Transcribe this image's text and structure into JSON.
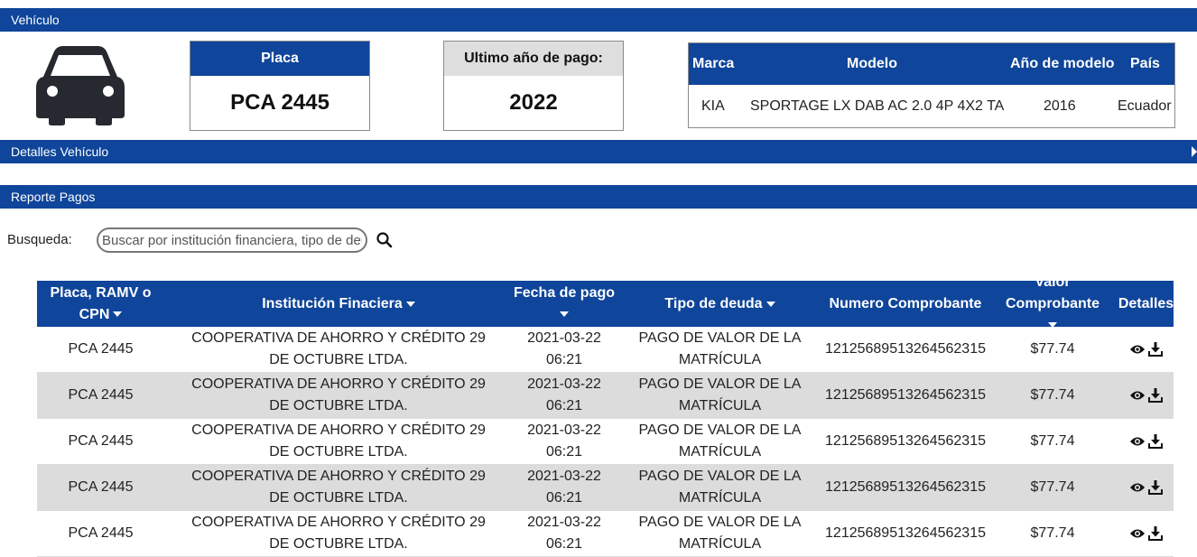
{
  "sections": {
    "vehicle": "Vehículo",
    "vehicle_details": "Detalles Vehículo",
    "payments_report": "Reporte Pagos"
  },
  "plate_card": {
    "label": "Placa",
    "value": "PCA 2445"
  },
  "last_payment_card": {
    "label": "Ultimo año de pago:",
    "value": "2022"
  },
  "vehicle_info": {
    "headers": {
      "brand": "Marca",
      "model": "Modelo",
      "model_year": "Año de modelo",
      "country": "País"
    },
    "values": {
      "brand": "KIA",
      "model": "SPORTAGE LX DAB AC 2.0 4P 4X2 TA",
      "model_year": "2016",
      "country": "Ecuador"
    }
  },
  "search": {
    "label": "Busqueda:",
    "placeholder": "Buscar por institución financiera, tipo de deuda",
    "value": ""
  },
  "table": {
    "headers": {
      "plate_line1": "Placa, RAMV o",
      "plate_line2": "CPN",
      "institution": "Institución Finaciera",
      "date": "Fecha de pago",
      "debt_type": "Tipo de deuda",
      "receipt_number": "Numero Comprobante",
      "receipt_value": "Valor Comprobante",
      "details": "Detalles"
    },
    "rows": [
      {
        "plate": "PCA 2445",
        "institution": "COOPERATIVA DE AHORRO Y CRÉDITO 29 DE OCTUBRE LTDA.",
        "date": "2021-03-22 06:21",
        "debt_type": "PAGO DE VALOR DE LA MATRÍCULA",
        "receipt_number": "12125689513264562315",
        "value": "$77.74"
      },
      {
        "plate": "PCA 2445",
        "institution": "COOPERATIVA DE AHORRO Y CRÉDITO 29 DE OCTUBRE LTDA.",
        "date": "2021-03-22 06:21",
        "debt_type": "PAGO DE VALOR DE LA MATRÍCULA",
        "receipt_number": "12125689513264562315",
        "value": "$77.74"
      },
      {
        "plate": "PCA 2445",
        "institution": "COOPERATIVA DE AHORRO Y CRÉDITO 29 DE OCTUBRE LTDA.",
        "date": "2021-03-22 06:21",
        "debt_type": "PAGO DE VALOR DE LA MATRÍCULA",
        "receipt_number": "12125689513264562315",
        "value": "$77.74"
      },
      {
        "plate": "PCA 2445",
        "institution": "COOPERATIVA DE AHORRO Y CRÉDITO 29 DE OCTUBRE LTDA.",
        "date": "2021-03-22 06:21",
        "debt_type": "PAGO DE VALOR DE LA MATRÍCULA",
        "receipt_number": "12125689513264562315",
        "value": "$77.74"
      },
      {
        "plate": "PCA 2445",
        "institution": "COOPERATIVA DE AHORRO Y CRÉDITO 29 DE OCTUBRE LTDA.",
        "date": "2021-03-22 06:21",
        "debt_type": "PAGO DE VALOR DE LA MATRÍCULA",
        "receipt_number": "12125689513264562315",
        "value": "$77.74"
      }
    ]
  },
  "icons": {
    "vehicle": "car-icon",
    "search": "search-icon",
    "view": "eye-icon",
    "download": "download-icon",
    "expand": "triangle-right-icon"
  },
  "colors": {
    "primary": "#0f459a",
    "row_alt": "#dcdcdc",
    "card_grey": "#dedede"
  }
}
